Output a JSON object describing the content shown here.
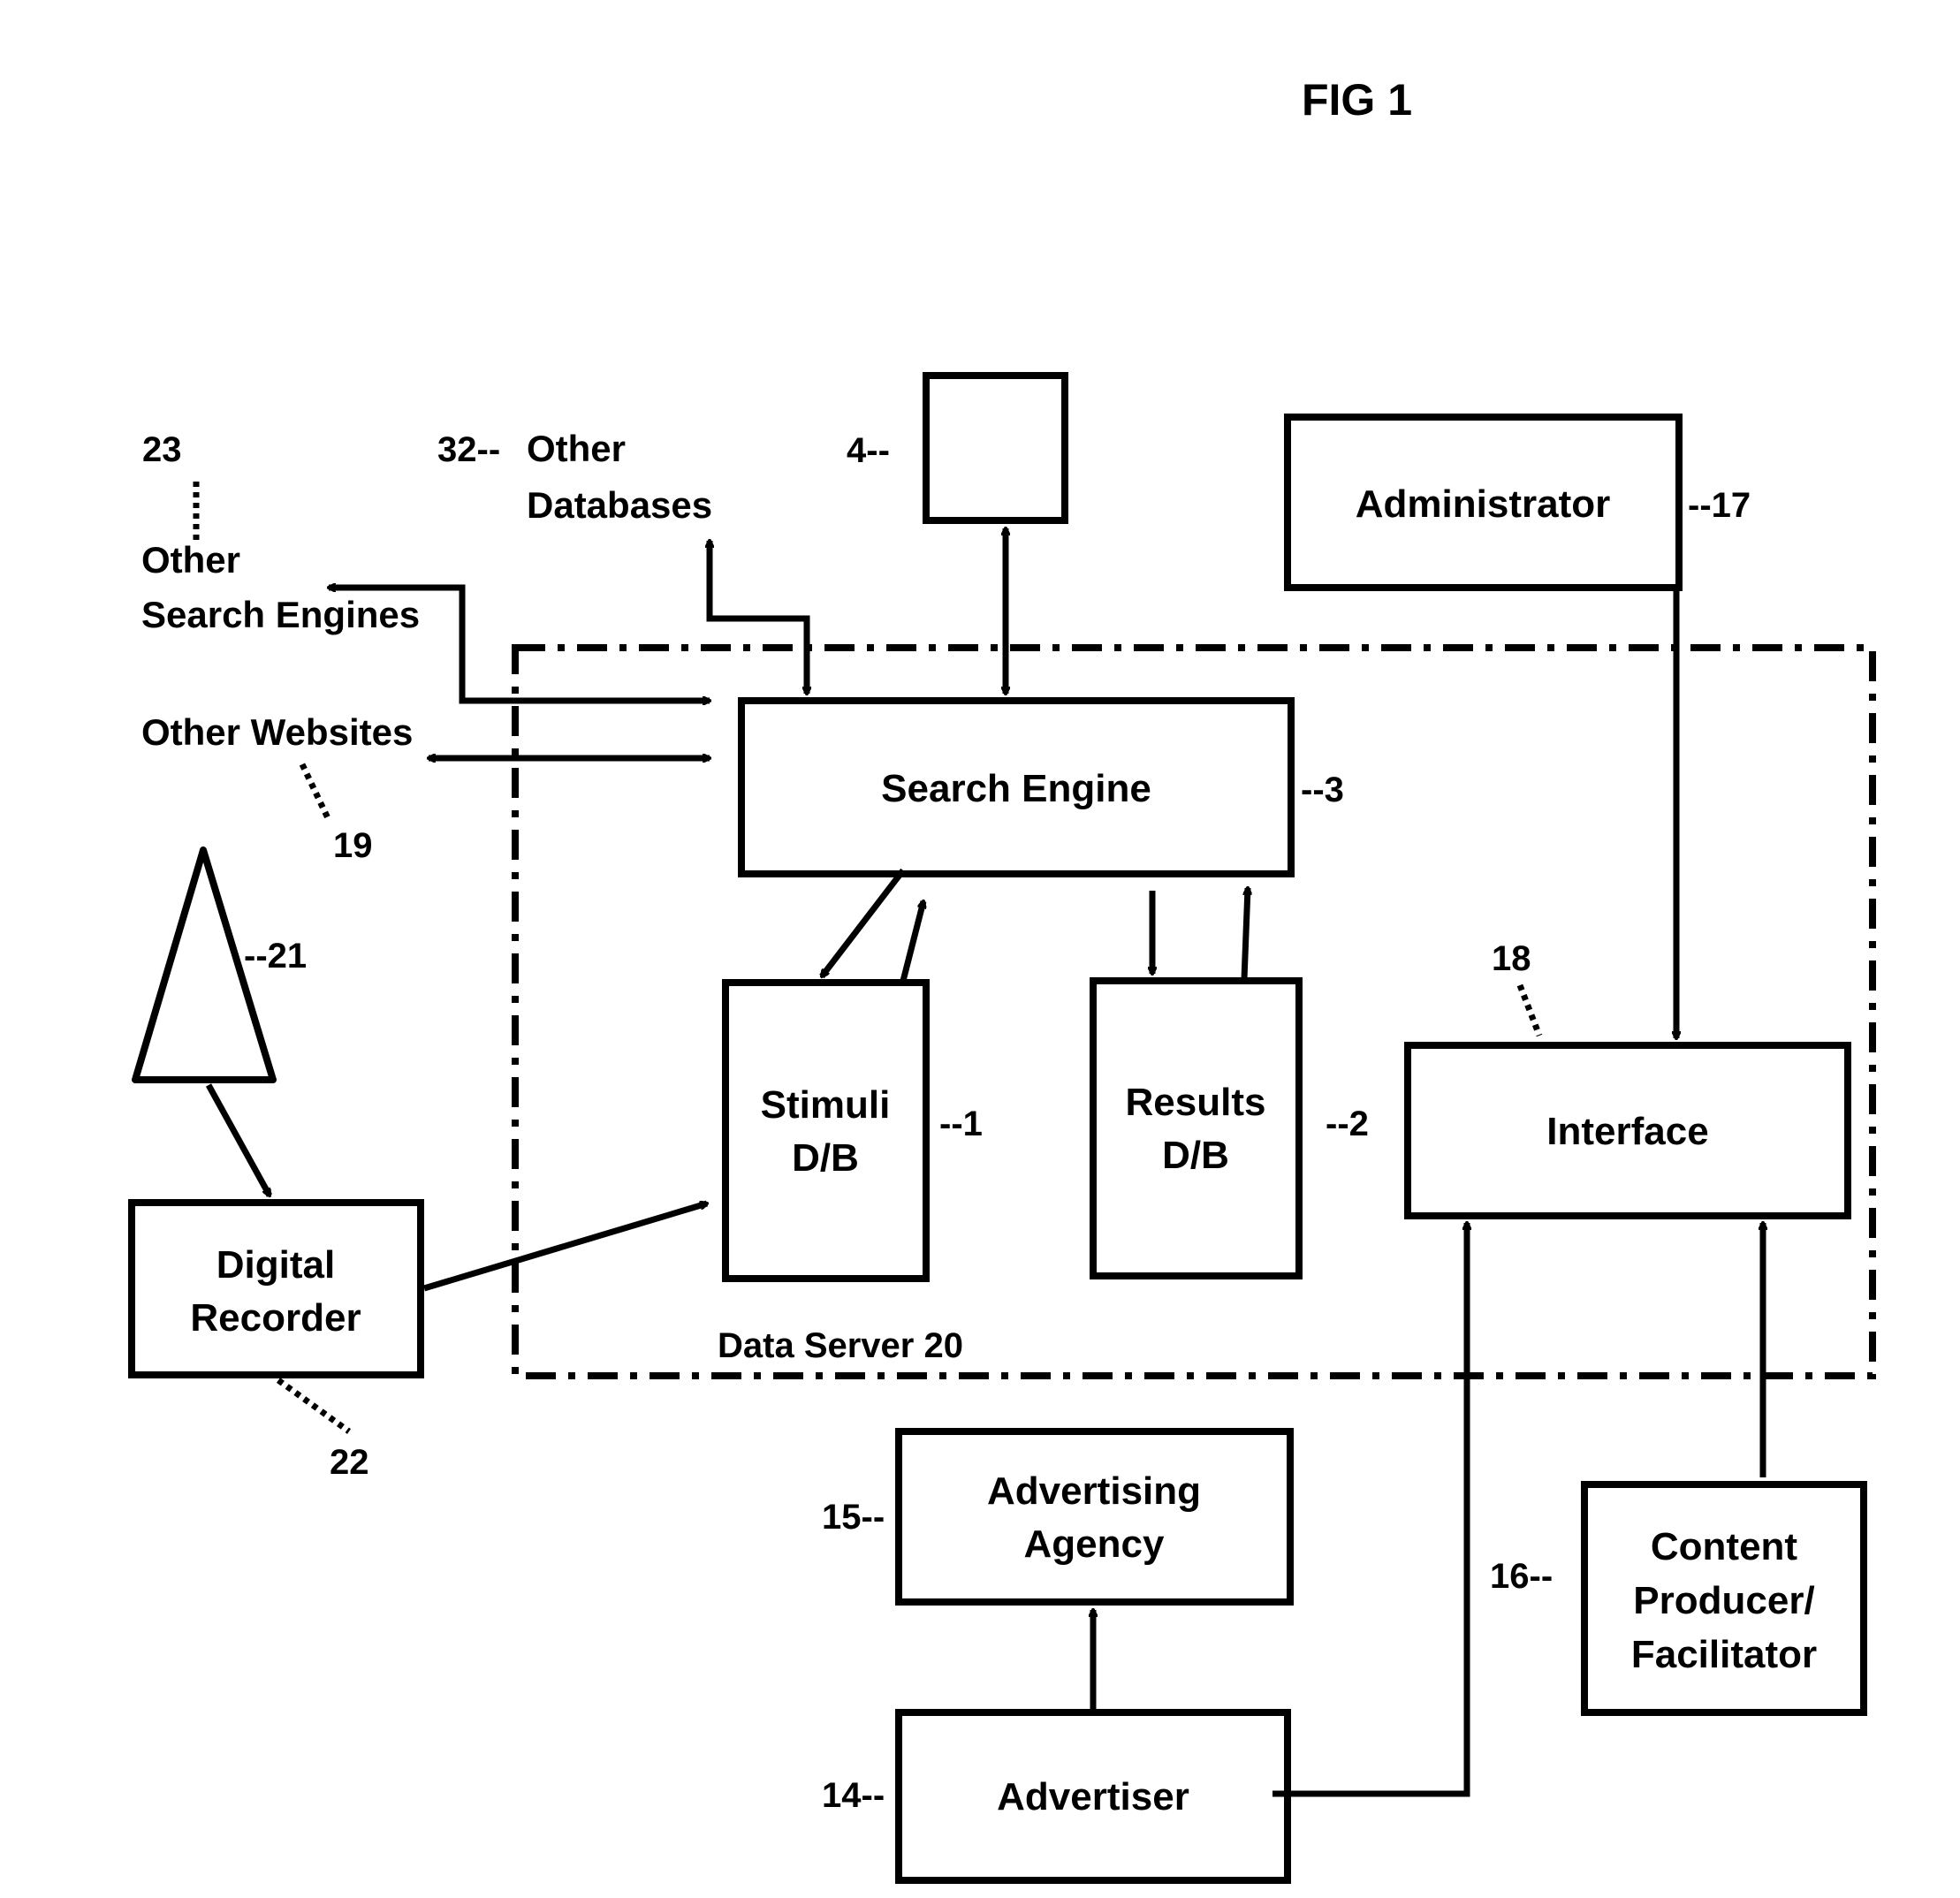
{
  "figure": {
    "title": "FIG 1"
  },
  "container": {
    "label": "Data Server 20"
  },
  "nodes": {
    "search_engine": {
      "label": [
        "Search Engine"
      ],
      "ref": "--3"
    },
    "stimuli_db": {
      "label": [
        "Stimuli",
        "D/B"
      ],
      "ref": "--1"
    },
    "results_db": {
      "label": [
        "Results",
        "D/B"
      ],
      "ref": "--2"
    },
    "interface": {
      "label": [
        "Interface"
      ],
      "ref": "18"
    },
    "administrator": {
      "label": [
        "Administrator"
      ],
      "ref": "--17"
    },
    "unlabeled_box": {
      "label": [],
      "ref": "4--"
    },
    "digital_recorder": {
      "label": [
        "Digital",
        "Recorder"
      ],
      "ref": "22"
    },
    "antenna": {
      "label": [],
      "ref": "--21"
    },
    "advertising_agency": {
      "label": [
        "Advertising",
        "Agency"
      ],
      "ref": "15--"
    },
    "advertiser": {
      "label": [
        "Advertiser"
      ],
      "ref": "14--"
    },
    "content_producer": {
      "label": [
        "Content",
        "Producer/",
        "Facilitator"
      ],
      "ref": "16--"
    },
    "other_search_engines": {
      "label": [
        "Other",
        "Search Engines"
      ],
      "ref": "23"
    },
    "other_databases": {
      "label": [
        "Other",
        "Databases"
      ],
      "ref": "32--"
    },
    "other_websites": {
      "label": [
        "Other Websites"
      ],
      "ref": "19"
    }
  },
  "edges": [
    {
      "from": "unlabeled_box",
      "to": "search_engine",
      "direction": "bidirectional"
    },
    {
      "from": "search_engine",
      "to": "other_search_engines",
      "direction": "bidirectional"
    },
    {
      "from": "search_engine",
      "to": "other_databases",
      "direction": "bidirectional"
    },
    {
      "from": "search_engine",
      "to": "other_websites",
      "direction": "bidirectional"
    },
    {
      "from": "search_engine",
      "to": "stimuli_db",
      "direction": "bidirectional"
    },
    {
      "from": "search_engine",
      "to": "results_db",
      "direction": "bidirectional"
    },
    {
      "from": "administrator",
      "to": "interface",
      "direction": "forward"
    },
    {
      "from": "antenna",
      "to": "digital_recorder",
      "direction": "forward"
    },
    {
      "from": "digital_recorder",
      "to": "stimuli_db",
      "direction": "forward"
    },
    {
      "from": "advertiser",
      "to": "advertising_agency",
      "direction": "forward"
    },
    {
      "from": "advertiser",
      "to": "interface",
      "direction": "forward"
    },
    {
      "from": "content_producer",
      "to": "interface",
      "direction": "forward"
    }
  ]
}
